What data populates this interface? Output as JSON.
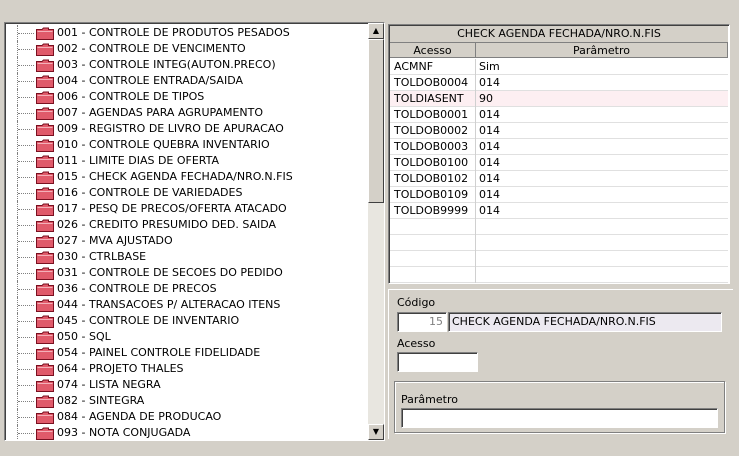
{
  "tree": {
    "items": [
      "001 - CONTROLE DE PRODUTOS PESADOS",
      "002 - CONTROLE DE VENCIMENTO",
      "003 - CONTROLE INTEG(AUTON.PRECO)",
      "004 - CONTROLE ENTRADA/SAIDA",
      "006 - CONTROLE DE TIPOS",
      "007 - AGENDAS PARA AGRUPAMENTO",
      "009 - REGISTRO DE LIVRO DE APURACAO",
      "010 - CONTROLE QUEBRA INVENTARIO",
      "011 - LIMITE DIAS DE OFERTA",
      "015 - CHECK AGENDA FECHADA/NRO.N.FIS",
      "016 - CONTROLE DE VARIEDADES",
      "017 - PESQ DE PRECOS/OFERTA ATACADO",
      "026 - CREDITO PRESUMIDO DED. SAIDA",
      "027 - MVA AJUSTADO",
      "030 - CTRLBASE",
      "031 - CONTROLE DE SECOES DO PEDIDO",
      "036 - CONTROLE DE PRECOS",
      "044 - TRANSACOES P/ ALTERACAO ITENS",
      "045 - CONTROLE DE INVENTARIO",
      "050 - SQL",
      "054 - PAINEL CONTROLE FIDELIDADE",
      "064 - PROJETO THALES",
      "074 - LISTA NEGRA",
      "082 - SINTEGRA",
      "084 - AGENDA DE PRODUCAO",
      "093 - NOTA CONJUGADA"
    ],
    "scroll_up": "▲",
    "scroll_down": "▼"
  },
  "grid": {
    "title": "CHECK AGENDA FECHADA/NRO.N.FIS",
    "col_acesso": "Acesso",
    "col_parametro": "Parâmetro",
    "rows": [
      {
        "acesso": "ACMNF",
        "parametro": "Sim"
      },
      {
        "acesso": "TOLDOB0004",
        "parametro": "014"
      },
      {
        "acesso": "TOLDIASENT",
        "parametro": "90"
      },
      {
        "acesso": "TOLDOB0001",
        "parametro": "014"
      },
      {
        "acesso": "TOLDOB0002",
        "parametro": "014"
      },
      {
        "acesso": "TOLDOB0003",
        "parametro": "014"
      },
      {
        "acesso": "TOLDOB0100",
        "parametro": "014"
      },
      {
        "acesso": "TOLDOB0102",
        "parametro": "014"
      },
      {
        "acesso": "TOLDOB0109",
        "parametro": "014"
      },
      {
        "acesso": "TOLDOB9999",
        "parametro": "014"
      },
      {
        "acesso": "",
        "parametro": ""
      },
      {
        "acesso": "",
        "parametro": ""
      },
      {
        "acesso": "",
        "parametro": ""
      },
      {
        "acesso": "",
        "parametro": ""
      }
    ]
  },
  "form": {
    "codigo_label": "Código",
    "codigo_value": "15",
    "codigo_desc": "CHECK AGENDA FECHADA/NRO.N.FIS",
    "acesso_label": "Acesso",
    "acesso_value": "",
    "parametro_label": "Parâmetro",
    "parametro_value": ""
  }
}
